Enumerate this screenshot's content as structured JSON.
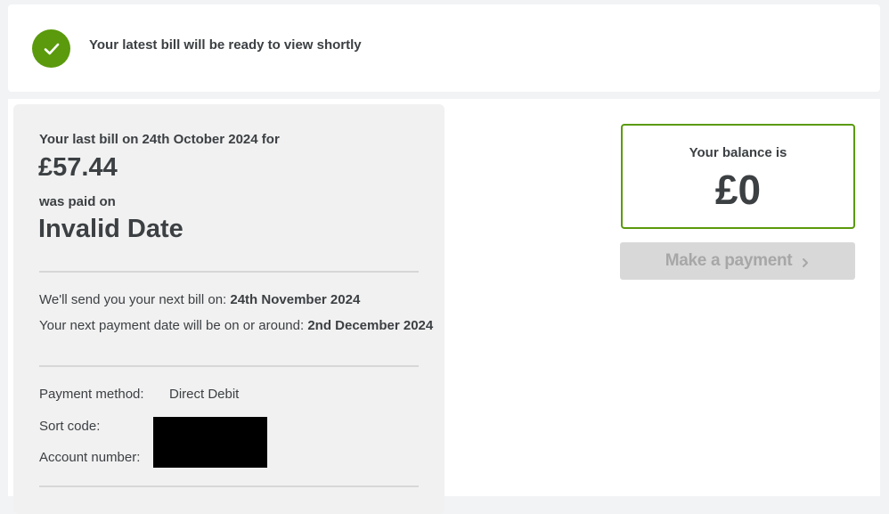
{
  "notice": {
    "icon": "check-icon",
    "accent_color": "#5a9a0c",
    "text": "Your latest bill will be ready to view shortly"
  },
  "bill": {
    "intro": "Your last bill on 24th October 2024 for",
    "amount": "£57.44",
    "paid_label": "was paid on",
    "paid_date": "Invalid Date",
    "next_bill_label": "We'll send you your next bill on:",
    "next_bill_date": "24th November 2024",
    "next_payment_label": "Your next payment date will be on or around:",
    "next_payment_date": "2nd December 2024"
  },
  "payment_details": {
    "method_label": "Payment method:",
    "method_value": "Direct Debit",
    "sort_code_label": "Sort code:",
    "account_number_label": "Account number:"
  },
  "balance": {
    "label": "Your balance is",
    "value": "£0",
    "border_color": "#5a9a0c"
  },
  "actions": {
    "make_payment_label": "Make a payment",
    "make_payment_icon": "chevron-right-icon"
  }
}
